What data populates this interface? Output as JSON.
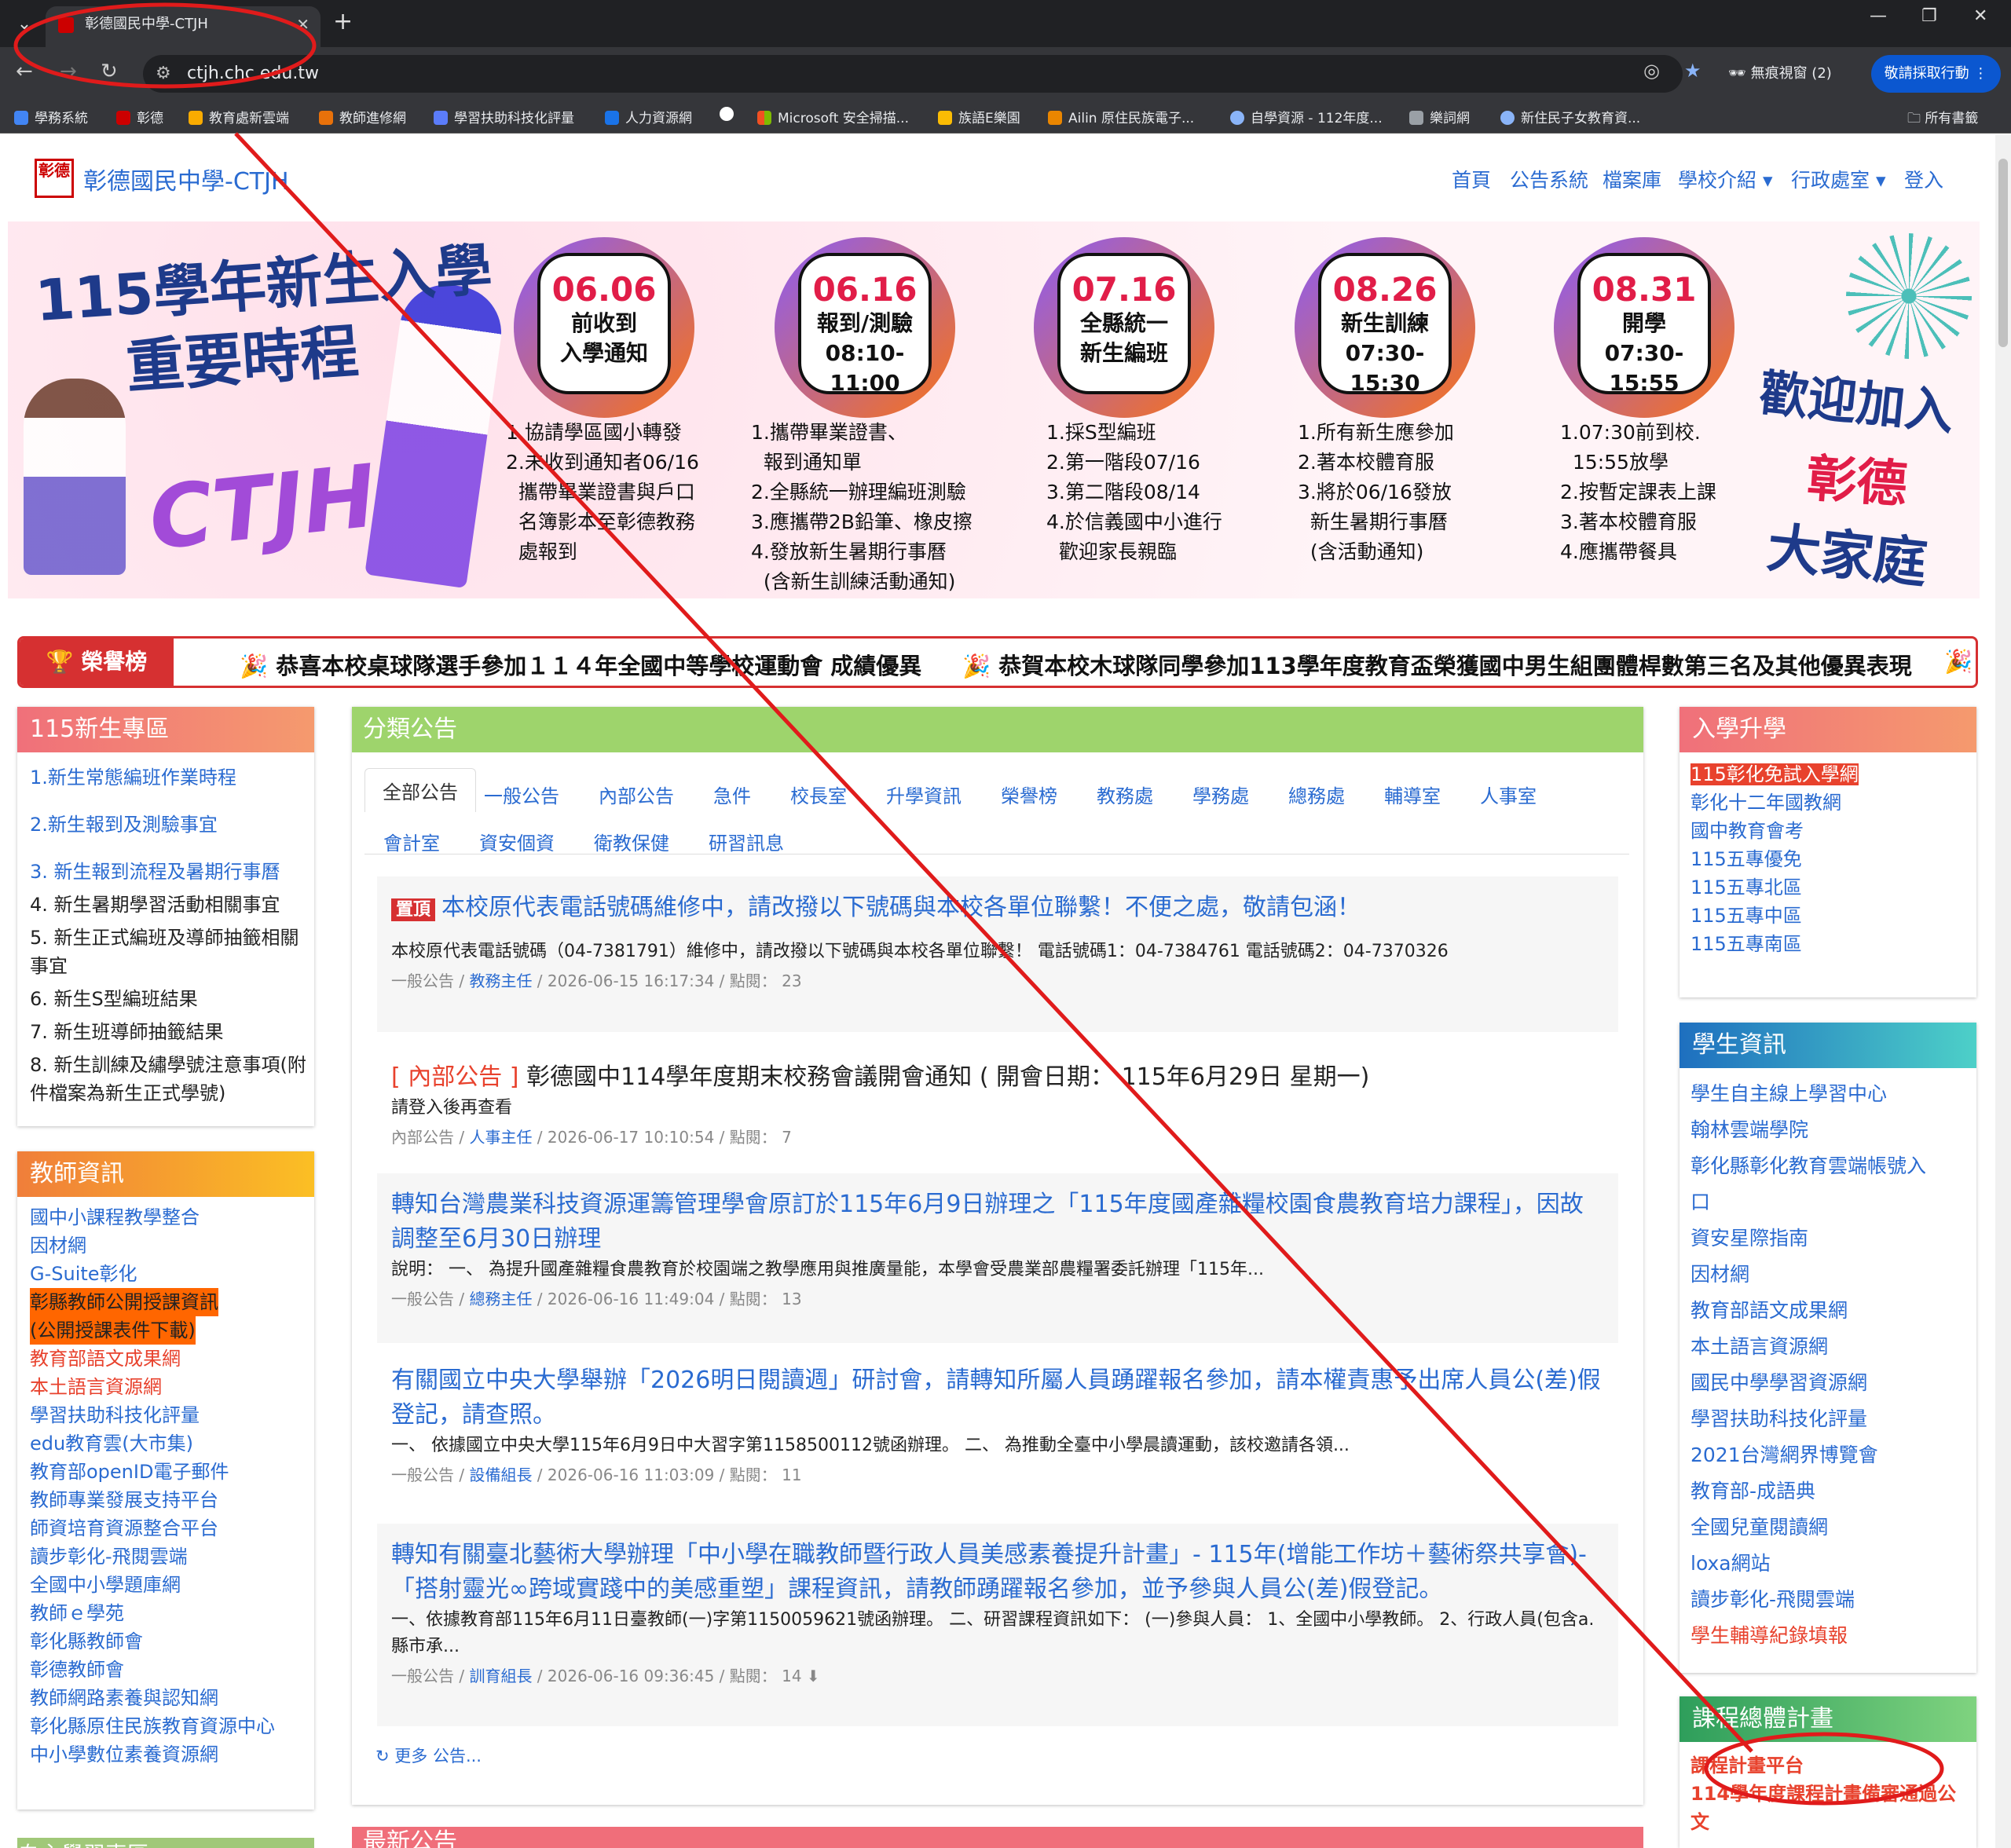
{
  "browser": {
    "tab_title": "彰德國民中學-CTJH",
    "url": "ctjh.chc.edu.tw",
    "incognito": "無痕視窗 (2)",
    "pause_button": "敬請採取行動",
    "bookmarks": [
      "學務系統",
      "彰德",
      "教育處新雲端",
      "教師進修網",
      "學習扶助科技化評量",
      "人力資源網",
      "",
      "Microsoft 安全掃描...",
      "族語E樂園",
      "Ailin 原住民族電子...",
      "自學資源 - 112年度...",
      "樂詞網",
      "新住民子女教育資...",
      "所有書籤"
    ]
  },
  "site": {
    "title": "彰德國民中學-CTJH",
    "logo_text": "彰德",
    "nav": [
      "首頁",
      "公告系統",
      "檔案庫",
      "學校介紹 ▾",
      "行政處室 ▾",
      "登入"
    ]
  },
  "banner": {
    "title_line1": "115學年新生入學",
    "title_line2": "重要時程",
    "ctjh": "CTJH",
    "events": [
      {
        "date": "06.06",
        "l1": "前收到",
        "l2": "入學通知",
        "steps": "1.協請學區國小轉發\n2.未收到通知者06/16\n  攜帶畢業證書與戶口\n  名簿影本至彰德教務\n  處報到"
      },
      {
        "date": "06.16",
        "l1": "報到/測驗",
        "l2": "08:10-11:00",
        "steps": "1.攜帶畢業證書、\n  報到通知單\n2.全縣統一辦理編班測驗\n3.應攜帶2B鉛筆、橡皮擦\n4.發放新生暑期行事曆\n  (含新生訓練活動通知)"
      },
      {
        "date": "07.16",
        "l1": "全縣統一",
        "l2": "新生編班",
        "steps": "1.採S型編班\n2.第一階段07/16\n3.第二階段08/14\n4.於信義國中小進行\n  歡迎家長親臨"
      },
      {
        "date": "08.26",
        "l1": "新生訓練",
        "l2": "07:30-15:30",
        "steps": "1.所有新生應參加\n2.著本校體育服\n3.將於06/16發放\n  新生暑期行事曆\n  (含活動通知)"
      },
      {
        "date": "08.31",
        "l1": "開學",
        "l2": "07:30-15:55",
        "steps": "1.07:30前到校.\n  15:55放學\n2.按暫定課表上課\n3.著本校體育服\n4.應攜帶餐具"
      }
    ],
    "welcome1": "歡迎加入",
    "welcome2": "彰德",
    "welcome3": "大家庭"
  },
  "honor": {
    "label": "🏆 榮譽榜",
    "items": [
      "🎉 恭喜本校桌球隊選手參加１１４年全國中等學校運動會 成績優異",
      "🎉 恭賀本校木球隊同學參加113學年度教育盃榮獲國中男生組團體桿數第三名及其他優異表現",
      "🎉"
    ]
  },
  "left": {
    "newstudent": {
      "title": "115新生專區",
      "items": [
        "1.新生常態編班作業時程",
        "2.新生報到及測驗事宜",
        "3. 新生報到流程及暑期行事曆",
        "4. 新生暑期學習活動相關事宜",
        "5. 新生正式編班及導師抽籤相關",
        "事宜",
        "6. 新生S型編班結果",
        "7. 新生班導師抽籤結果",
        "8. 新生訓練及繡學號注意事項(附",
        "件檔案為新生正式學號)"
      ]
    },
    "teacher": {
      "title": "教師資訊",
      "items": [
        "國中小課程教學整合",
        "因材網",
        "G-Suite彰化",
        "彰縣教師公開授課資訊",
        "(公開授課表件下載)",
        "教育部語文成果網",
        "本土語言資源網",
        "學習扶助科技化評量",
        "edu教育雲(大市集)",
        "教育部openID電子郵件",
        "教師專業發展支持平台",
        "師資培育資源整合平台",
        "讀步彰化-飛閱雲端",
        "全國中小學題庫網",
        "教師ｅ學苑",
        "彰化縣教師會",
        "彰德教師會",
        "教師網路素養與認知網",
        "彰化縣原住民族教育資源中心",
        "中小學數位素養資源網"
      ]
    },
    "next_title": "自主學習專區"
  },
  "main": {
    "title": "分類公告",
    "tabs_row1": [
      "全部公告",
      "一般公告",
      "內部公告",
      "急件",
      "校長室",
      "升學資訊",
      "榮譽榜",
      "教務處",
      "學務處",
      "總務處",
      "輔導室",
      "人事室"
    ],
    "tabs_row2": [
      "會計室",
      "資安個資",
      "衛教保健",
      "研習訊息"
    ],
    "posts": [
      {
        "pin": "置頂",
        "title": "本校原代表電話號碼維修中，請改撥以下號碼與本校各單位聯繫！不便之處，敬請包涵！",
        "desc": "本校原代表電話號碼（04-7381791）維修中，請改撥以下號碼與本校各單位聯繫！ 電話號碼1：04-7384761 電話號碼2：04-7370326",
        "cat": "一般公告 / ",
        "author": "教務主任",
        "meta": " / 2026-06-15 16:17:34 / 點閱： 23"
      },
      {
        "tag": "[ 內部公告 ]",
        "title": " 彰德國中114學年度期末校務會議開會通知 ( 開會日期： 115年6月29日 星期一)",
        "desc": "請登入後再查看",
        "cat": "內部公告 / ",
        "author": "人事主任",
        "meta": " / 2026-06-17 10:10:54 / 點閱： 7"
      },
      {
        "title": "轉知台灣農業科技資源運籌管理學會原訂於115年6月9日辦理之「115年度國產雜糧校園食農教育培力課程」，因故調整至6月30日辦理",
        "desc": "說明： 一、 為提升國產雜糧食農教育於校園端之教學應用與推廣量能，本學會受農業部農糧署委託辦理「115年...",
        "cat": "一般公告 / ",
        "author": "總務主任",
        "meta": " / 2026-06-16 11:49:04 / 點閱： 13"
      },
      {
        "title": "有關國立中央大學舉辦「2026明日閱讀週」研討會，請轉知所屬人員踴躍報名參加，請本權責惠予出席人員公(差)假登記，請查照。",
        "desc": "一、 依據國立中央大學115年6月9日中大習字第1158500112號函辦理。 二、 為推動全臺中小學晨讀運動，該校邀請各領...",
        "cat": "一般公告 / ",
        "author": "設備組長",
        "meta": " / 2026-06-16 11:03:09 / 點閱： 11"
      },
      {
        "title": "轉知有關臺北藝術大學辦理「中小學在職教師暨行政人員美感素養提升計畫」- 115年(增能工作坊＋藝術祭共享會)-「搭射靈光∞跨域實踐中的美感重塑」課程資訊，請教師踴躍報名參加，並予參與人員公(差)假登記。",
        "desc": "一、依據教育部115年6月11日臺教師(一)字第1150059621號函辦理。 二、研習課程資訊如下： (一)參與人員： 1、全國中小學教師。 2、行政人員(包含a.縣市承...",
        "cat": "一般公告 / ",
        "author": "訓育組長",
        "meta": " / 2026-06-16 09:36:45 / 點閱： 14 ⬇"
      }
    ],
    "more": "↻ 更多 公告...",
    "next_title": "最新公告"
  },
  "right": {
    "admission": {
      "title": "入學升學",
      "items": [
        "115彰化免試入學網",
        "彰化十二年國教網",
        "國中教育會考",
        "115五專優免",
        "115五專北區",
        "115五專中區",
        "115五專南區"
      ]
    },
    "student": {
      "title": "學生資訊",
      "items": [
        "學生自主線上學習中心",
        "翰林雲端學院",
        "彰化縣彰化教育雲端帳號入",
        "口",
        "資安星際指南",
        "因材網",
        "教育部語文成果網",
        "本土語言資源網",
        "國民中學學習資源網",
        "學習扶助科技化評量",
        "2021台灣網界博覽會",
        "教育部-成語典",
        "全國兒童閱讀網",
        "loxa網站",
        "讀步彰化-飛閱雲端",
        "學生輔導紀錄填報"
      ]
    },
    "curriculum": {
      "title": "課程總體計畫",
      "items": [
        "課程計畫平台",
        "114學年度課程計畫備審通過公",
        "文"
      ]
    }
  }
}
